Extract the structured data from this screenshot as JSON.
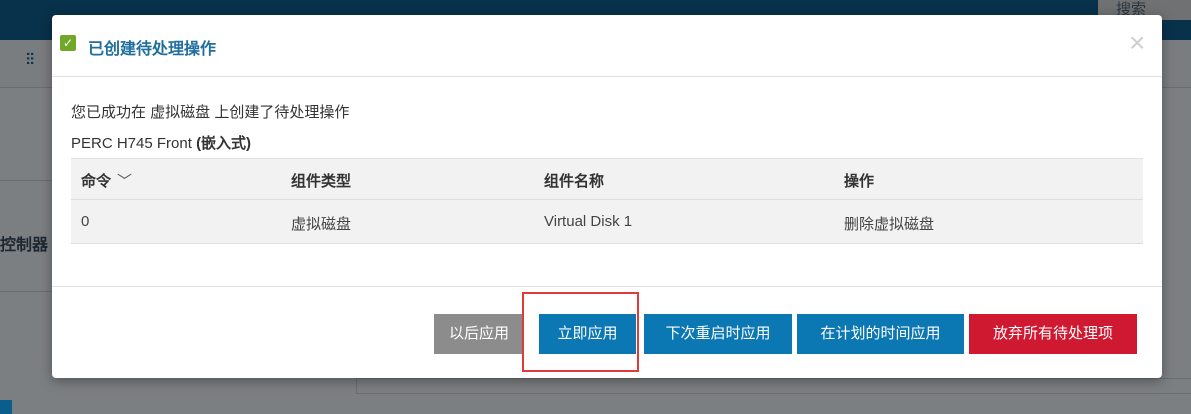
{
  "background": {
    "search_tab_label": "搜索",
    "filter_icon": "sliders-icon",
    "side_label": "控制器"
  },
  "modal": {
    "title": "已创建待处理操作",
    "title_icon": "check-icon",
    "close_icon": "close-icon",
    "message": "您已成功在 虚拟磁盘 上创建了待处理操作",
    "controller_name": "PERC H745 Front",
    "controller_suffix": "(嵌入式)",
    "table": {
      "headers": [
        "命令",
        "组件类型",
        "组件名称",
        "操作"
      ],
      "rows": [
        [
          "0",
          "虚拟磁盘",
          "Virtual Disk 1",
          "删除虚拟磁盘"
        ]
      ]
    },
    "buttons": {
      "apply_later": "以后应用",
      "apply_now": "立即应用",
      "apply_next_reboot": "下次重启时应用",
      "apply_scheduled": "在计划的时间应用",
      "discard_all": "放弃所有待处理项"
    },
    "colors": {
      "primary": "#0b77b3",
      "danger": "#cf1931",
      "disabled": "#8c8c8c",
      "title": "#1f6e9e",
      "success": "#72a82a"
    }
  }
}
